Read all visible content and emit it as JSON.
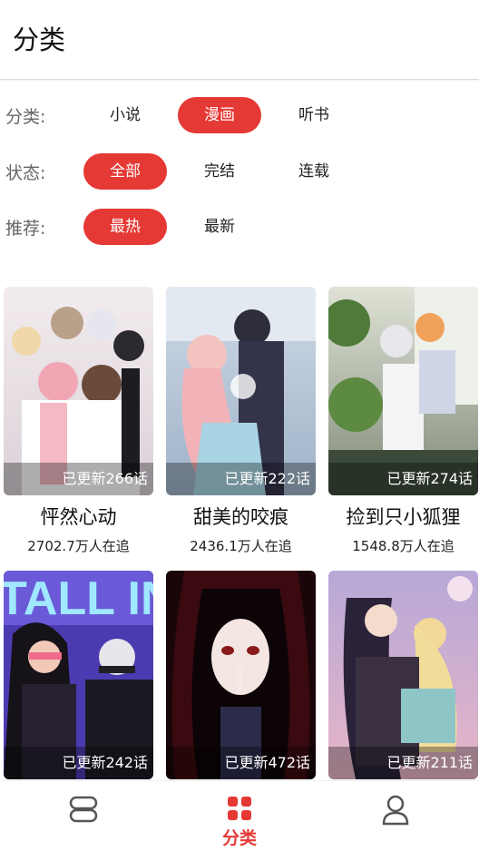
{
  "header": {
    "title": "分类"
  },
  "filters": {
    "category": {
      "label": "分类:",
      "options": [
        "小说",
        "漫画",
        "听书"
      ],
      "selected": "漫画"
    },
    "status": {
      "label": "状态:",
      "options": [
        "全部",
        "完结",
        "连载"
      ],
      "selected": "全部"
    },
    "recommend": {
      "label": "推荐:",
      "options": [
        "最热",
        "最新"
      ],
      "selected": "最热"
    }
  },
  "comics": [
    {
      "title": "怦然心动",
      "updated": "已更新266话",
      "readers": "2702.7万人在追"
    },
    {
      "title": "甜美的咬痕",
      "updated": "已更新222话",
      "readers": "2436.1万人在追"
    },
    {
      "title": "捡到只小狐狸",
      "updated": "已更新274话",
      "readers": "1548.8万人在追"
    },
    {
      "title": "",
      "updated": "已更新242话",
      "readers": "",
      "cover_text": "TALL IN"
    },
    {
      "title": "",
      "updated": "已更新472话",
      "readers": ""
    },
    {
      "title": "",
      "updated": "已更新211话",
      "readers": ""
    }
  ],
  "tabbar": {
    "tabs": [
      {
        "icon": "bookshelf-icon",
        "label": ""
      },
      {
        "icon": "category-grid-icon",
        "label": "分类",
        "active": true
      },
      {
        "icon": "user-profile-icon",
        "label": ""
      }
    ]
  },
  "colors": {
    "accent": "#e53935",
    "text": "#222222",
    "label": "#666666"
  }
}
